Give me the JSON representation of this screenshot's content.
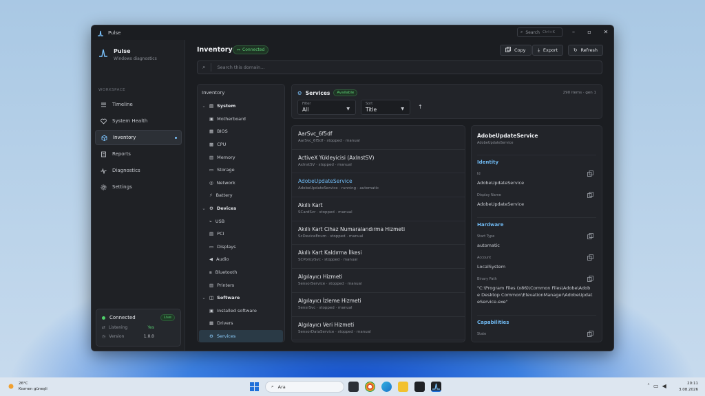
{
  "window": {
    "title": "Pulse",
    "search_label": "Search",
    "search_shortcut": "Ctrl+K"
  },
  "sidebar": {
    "app_name": "Pulse",
    "app_subtitle": "Windows diagnostics",
    "section_label": "WORKSPACE",
    "items": [
      {
        "label": "Timeline",
        "icon": "list-icon"
      },
      {
        "label": "System Health",
        "icon": "heart-icon"
      },
      {
        "label": "Inventory",
        "icon": "box-icon",
        "active": true
      },
      {
        "label": "Reports",
        "icon": "report-icon"
      },
      {
        "label": "Diagnostics",
        "icon": "pulse-icon"
      },
      {
        "label": "Settings",
        "icon": "gear-icon"
      }
    ],
    "connection": {
      "status": "Connected",
      "badge": "Live",
      "listening_label": "Listening",
      "listening_value": "Yes",
      "version_label": "Version",
      "version_value": "1.0.0"
    }
  },
  "header": {
    "title": "Inventory",
    "status_badge": "Connected",
    "copy_label": "Copy",
    "export_label": "Export",
    "refresh_label": "Refresh",
    "search_placeholder": "Search this domain..."
  },
  "tree": {
    "title": "Inventory",
    "groups": [
      {
        "label": "System",
        "children": [
          "Motherboard",
          "BIOS",
          "CPU",
          "Memory",
          "Storage",
          "Network",
          "Battery"
        ]
      },
      {
        "label": "Devices",
        "children": [
          "USB",
          "PCI",
          "Displays",
          "Audio",
          "Bluetooth",
          "Printers"
        ]
      },
      {
        "label": "Software",
        "children": [
          "Installed software",
          "Drivers",
          "Services"
        ]
      }
    ],
    "selected": "Services"
  },
  "services": {
    "title": "Services",
    "badge": "Available",
    "count_text": "290 items · gen 1",
    "filter_label": "Filter",
    "filter_value": "All",
    "sort_label": "Sort",
    "sort_value": "Title",
    "items": [
      {
        "name": "AarSvc_6f5df",
        "detail": "AarSvc_6f5df · stopped · manual"
      },
      {
        "name": "ActiveX Yükleyicisi (AxInstSV)",
        "detail": "AxInstSV · stopped · manual"
      },
      {
        "name": "AdobeUpdateService",
        "detail": "AdobeUpdateService · running · automatic",
        "selected": true
      },
      {
        "name": "Akıllı Kart",
        "detail": "SCardSvr · stopped · manual"
      },
      {
        "name": "Akıllı Kart Cihaz Numaralandırma Hizmeti",
        "detail": "ScDeviceEnum · stopped · manual"
      },
      {
        "name": "Akıllı Kart Kaldırma İlkesi",
        "detail": "SCPolicySvc · stopped · manual"
      },
      {
        "name": "Algılayıcı Hizmeti",
        "detail": "SensorService · stopped · manual"
      },
      {
        "name": "Algılayıcı İzleme Hizmeti",
        "detail": "SensrSvc · stopped · manual"
      },
      {
        "name": "Algılayıcı Veri Hizmeti",
        "detail": "SensorDataService · stopped · manual"
      }
    ]
  },
  "detail": {
    "title": "AdobeUpdateService",
    "subtitle": "AdobeUpdateService",
    "identity_label": "Identity",
    "id_label": "Id",
    "id_value": "AdobeUpdateService",
    "display_name_label": "Display Name",
    "display_name_value": "AdobeUpdateService",
    "hardware_label": "Hardware",
    "start_type_label": "Start Type",
    "start_type_value": "automatic",
    "account_label": "Account",
    "account_value": "LocalSystem",
    "binary_path_label": "Binary Path",
    "binary_path_value": "\"C:\\Program Files (x86)\\Common Files\\Adobe\\Adobe Desktop Common\\ElevationManager\\AdobeUpdateService.exe\"",
    "capabilities_label": "Capabilities",
    "state_label": "State"
  },
  "taskbar": {
    "weather_temp": "26°C",
    "weather_text": "Kısmen güneşli",
    "search_placeholder": "Ara",
    "time": "20:11",
    "date": "3.08.2026"
  },
  "colors": {
    "accent": "#6fb8f0",
    "success": "#55c46d",
    "window_bg": "#1b1d21"
  }
}
